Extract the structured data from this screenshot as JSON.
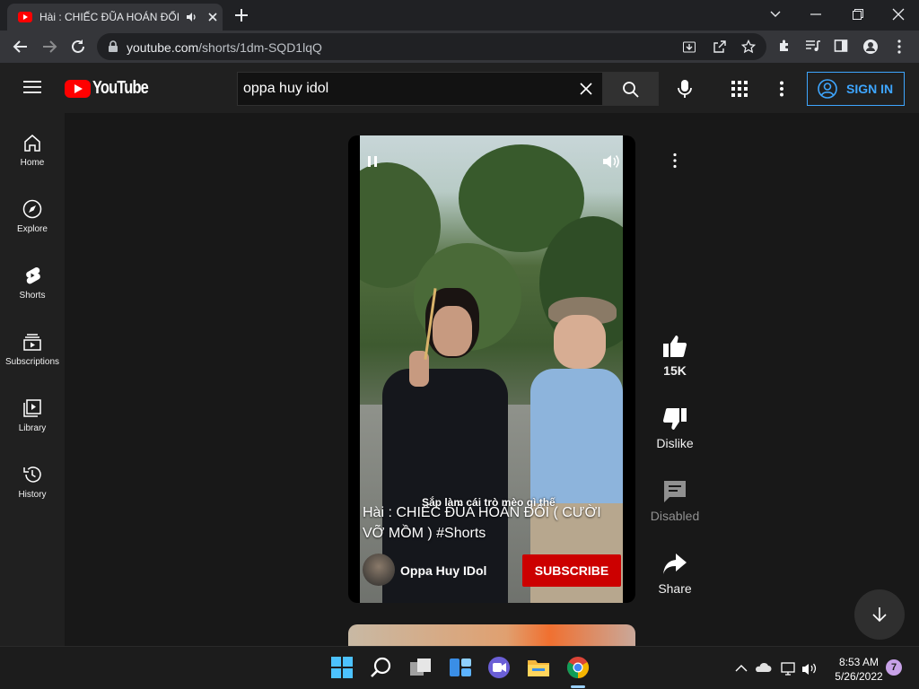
{
  "browser": {
    "tab_title": "Hài : CHIẾC ĐŨA HOÁN ĐỔI",
    "url_domain": "youtube.com",
    "url_path": "/shorts/1dm-SQD1lqQ"
  },
  "header": {
    "logo_text": "YouTube",
    "search_value": "oppa huy idol",
    "sign_in_label": "SIGN IN"
  },
  "sidebar": {
    "items": [
      {
        "label": "Home",
        "icon": "home-icon"
      },
      {
        "label": "Explore",
        "icon": "compass-icon"
      },
      {
        "label": "Shorts",
        "icon": "shorts-icon"
      },
      {
        "label": "Subscriptions",
        "icon": "subscriptions-icon"
      },
      {
        "label": "Library",
        "icon": "library-icon"
      },
      {
        "label": "History",
        "icon": "history-icon"
      }
    ]
  },
  "short": {
    "caption": "Sắp làm cái trò mèo gì thế",
    "title": "Hài : CHIẾC ĐŨA HOÁN ĐỔI ( CƯỜI VỠ MỒM ) #Shorts",
    "channel": "Oppa Huy IDol",
    "subscribe_label": "SUBSCRIBE"
  },
  "actions": {
    "likes": "15K",
    "dislike_label": "Dislike",
    "comments_label": "Disabled",
    "share_label": "Share"
  },
  "taskbar": {
    "time": "8:53 AM",
    "date": "5/26/2022",
    "notification_count": "7"
  },
  "colors": {
    "accent_blue": "#3ea6ff",
    "subscribe_red": "#cc0000",
    "youtube_red": "#ff0000"
  }
}
